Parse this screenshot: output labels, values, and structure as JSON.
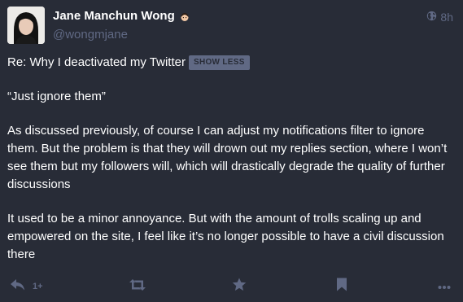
{
  "author": {
    "display_name": "Jane Manchun Wong",
    "handle": "@wongmjane",
    "emoji": "face-emoji"
  },
  "meta": {
    "visibility_icon": "globe-icon",
    "relative_time": "8h"
  },
  "post": {
    "content_warning": "Re: Why I deactivated my Twitter",
    "toggle_label": "SHOW LESS",
    "paragraphs": [
      "“Just ignore them”",
      "As discussed previously, of course I can adjust my notifications filter to ignore them. But the problem is that they will drown out my replies section, where I won’t see them but my followers will, which will drastically degrade the quality of further discussions",
      "It used to be a minor annoyance. But with the amount of trolls scaling up and empowered on the site, I feel like it’s no longer possible to have a civil discussion there"
    ]
  },
  "actions": {
    "reply_icon": "reply-icon",
    "reply_count": "1+",
    "boost_icon": "boost-icon",
    "favourite_icon": "star-icon",
    "bookmark_icon": "bookmark-icon",
    "more_icon": "more-icon"
  },
  "colors": {
    "background": "#282c37",
    "text": "#ffffff",
    "muted": "#606984"
  }
}
